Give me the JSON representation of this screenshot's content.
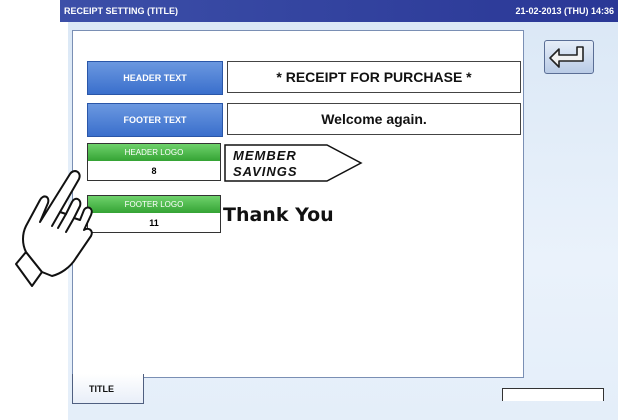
{
  "titlebar": {
    "title": "RECEIPT SETTING (TITLE)",
    "datetime": "21-02-2013 (THU) 14:36"
  },
  "header_text": {
    "label": "HEADER TEXT",
    "value": "* RECEIPT FOR PURCHASE *"
  },
  "footer_text": {
    "label": "FOOTER TEXT",
    "value": "Welcome again."
  },
  "header_logo": {
    "label": "HEADER LOGO",
    "number": "8",
    "logo_text": [
      "MEMBER",
      "SAVINGS"
    ]
  },
  "footer_logo": {
    "label": "FOOTER LOGO",
    "number": "11",
    "logo_text": "Thank You"
  },
  "tabs": [
    {
      "label": "TITLE"
    }
  ],
  "icons": {
    "back": "return-arrow-icon",
    "hand": "pointing-hand-icon"
  },
  "colors": {
    "titlebar": "#2a3796",
    "label_blue": "#3a6fcc",
    "label_green": "#34a334",
    "panel": "#dbe8f6"
  }
}
